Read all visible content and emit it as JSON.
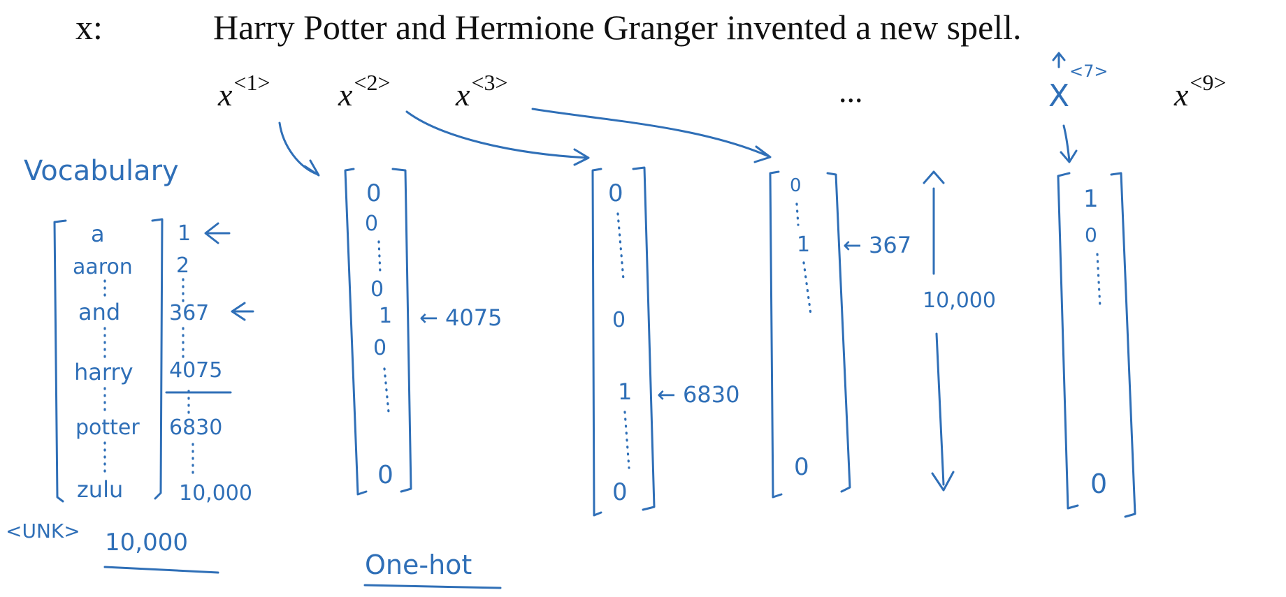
{
  "sentence": {
    "prefix": "x:",
    "text": "Harry Potter and Hermione Granger invented a new spell."
  },
  "tokens": {
    "x1": {
      "base": "x",
      "index": "<1>"
    },
    "x2": {
      "base": "x",
      "index": "<2>"
    },
    "x3": {
      "base": "x",
      "index": "<3>"
    },
    "ellipsis": "...",
    "x7": {
      "base": "X",
      "index": "<7>"
    },
    "x9": {
      "base": "x",
      "index": "<9>"
    }
  },
  "vocabulary": {
    "title": "Vocabulary",
    "words": [
      "a",
      "aaron",
      "and",
      "harry",
      "potter",
      "zulu"
    ],
    "indices": [
      "1",
      "2",
      "367",
      "4075",
      "6830",
      "10,000"
    ],
    "unk": "<UNK>",
    "size": "10,000"
  },
  "one_hot": {
    "caption": "One-hot",
    "vectors": [
      {
        "entries": [
          "0",
          "0",
          "0",
          "1",
          "0",
          "0"
        ],
        "annotation": "← 4075"
      },
      {
        "entries": [
          "0",
          "0",
          "1",
          "0"
        ],
        "annotation": "← 6830"
      },
      {
        "entries": [
          "0",
          "1",
          "0"
        ],
        "annotation": "← 367"
      },
      {
        "entries": [
          "1",
          "0",
          "0"
        ]
      }
    ],
    "dimension": "10,000"
  }
}
